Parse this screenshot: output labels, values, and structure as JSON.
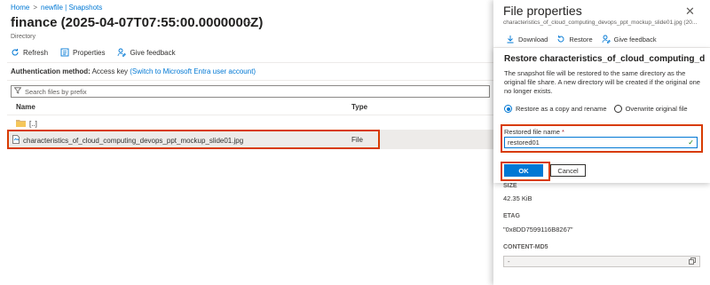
{
  "breadcrumb": [
    "Home",
    "newfile | Snapshots"
  ],
  "page": {
    "title": "finance (2025-04-07T07:55:00.0000000Z)",
    "more": "···",
    "subtitle": "Directory"
  },
  "toolbar": {
    "refresh": "Refresh",
    "properties": "Properties",
    "feedback": "Give feedback"
  },
  "auth": {
    "label": "Authentication method:",
    "value": "Access key",
    "link": "(Switch to Microsoft Entra user account)"
  },
  "search": {
    "placeholder": "Search files by prefix"
  },
  "table": {
    "columns": [
      "Name",
      "Type"
    ],
    "up_row": "[..]",
    "rows": [
      {
        "name": "characteristics_of_cloud_computing_devops_ppt_mockup_slide01.jpg",
        "type": "File"
      }
    ]
  },
  "panel": {
    "title": "File properties",
    "subtitle": "characteristics_of_cloud_computing_devops_ppt_mockup_slide01.jpg (20...",
    "download": "Download",
    "restore": "Restore",
    "feedback": "Give feedback",
    "props": [
      {
        "label": "SIZE",
        "value": "42.35 KiB"
      },
      {
        "label": "ETAG",
        "value": "\"0x8DD7599116B8267\""
      },
      {
        "label": "CONTENT-MD5",
        "value": "-"
      }
    ]
  },
  "dialog": {
    "title": "Restore characteristics_of_cloud_computing_d...",
    "text": "The snapshot file will be restored to the same directory as the original file share. A new directory will be created if the original one no longer exists.",
    "option1": "Restore as a copy and rename",
    "option2": "Overwrite original file",
    "field_label": "Restored file name",
    "field_required": "*",
    "field_value": "restored01",
    "ok": "OK",
    "cancel": "Cancel"
  },
  "colors": {
    "accent": "#0078d4",
    "highlight": "#d83b01",
    "success": "#107c10"
  }
}
